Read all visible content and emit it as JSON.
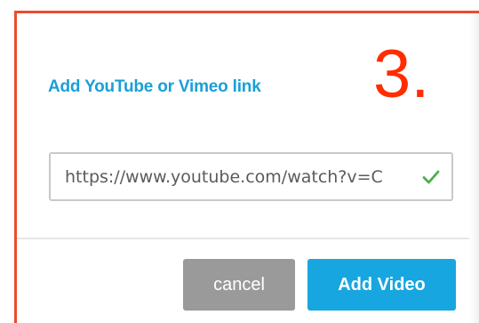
{
  "dialog": {
    "step_number": "3.",
    "section_label": "Add YouTube or Vimeo link",
    "url_value": "https://www.youtube.com/watch?v=C",
    "url_valid_icon": "check-icon",
    "cancel_label": "cancel",
    "add_label": "Add Video"
  },
  "colors": {
    "annotation_red": "#ee4a2e",
    "link_blue": "#1a9fd8",
    "button_blue": "#18a6e0",
    "button_gray": "#9a9a9a",
    "check_green": "#4caf50"
  }
}
